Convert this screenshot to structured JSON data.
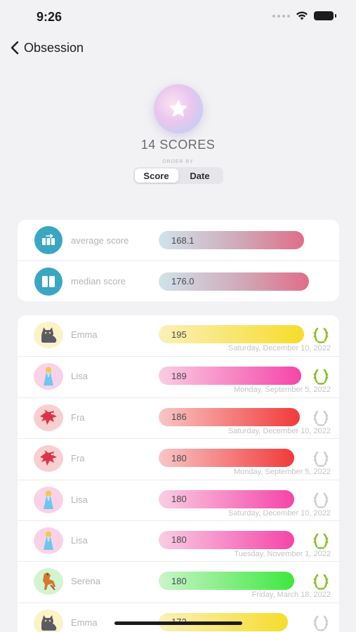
{
  "status_bar": {
    "time": "9:26"
  },
  "nav": {
    "back_title": "Obsession"
  },
  "header": {
    "scores_count": "14 SCORES",
    "order_by_label": "ORDER BY",
    "order_options": [
      "Score",
      "Date"
    ],
    "selected_order": "Score"
  },
  "stats": [
    {
      "label": "average score",
      "value": "168.1",
      "icon": "average-icon"
    },
    {
      "label": "median score",
      "value": "176.0",
      "icon": "median-icon"
    }
  ],
  "scores": [
    {
      "name": "Emma",
      "score": "195",
      "date": "Saturday, December 10, 2022",
      "avatar": "cat-icon",
      "avatar_bg": "#fbf3c8",
      "bar_from": "#fbf0b8",
      "bar_to": "#f6dc2c",
      "bar_fraction": 1.0,
      "laurel_color": "#8fbf2a"
    },
    {
      "name": "Lisa",
      "score": "189",
      "date": "Monday, September 5, 2022",
      "avatar": "princess-icon",
      "avatar_bg": "#f9d2e8",
      "bar_from": "#f9cde3",
      "bar_to": "#f545a8",
      "bar_fraction": 0.98,
      "laurel_color": "#8fbf2a"
    },
    {
      "name": "Fra",
      "score": "186",
      "date": "Saturday, December 10, 2022",
      "avatar": "dragon-icon",
      "avatar_bg": "#f8cfcf",
      "bar_from": "#f8c6c6",
      "bar_to": "#f23a3a",
      "bar_fraction": 0.97,
      "laurel_color": "#cfcfd2"
    },
    {
      "name": "Fra",
      "score": "180",
      "date": "Monday, September 5, 2022",
      "avatar": "dragon-icon",
      "avatar_bg": "#f8cfcf",
      "bar_from": "#f8c6c6",
      "bar_to": "#f23a3a",
      "bar_fraction": 0.93,
      "laurel_color": "#cfcfd2"
    },
    {
      "name": "Lisa",
      "score": "180",
      "date": "Saturday, December 10, 2022",
      "avatar": "princess-icon",
      "avatar_bg": "#f9d2e8",
      "bar_from": "#f9cde3",
      "bar_to": "#f545a8",
      "bar_fraction": 0.93,
      "laurel_color": "#cfcfd2"
    },
    {
      "name": "Lisa",
      "score": "180",
      "date": "Tuesday, November 1, 2022",
      "avatar": "princess-icon",
      "avatar_bg": "#f9d2e8",
      "bar_from": "#f9cde3",
      "bar_to": "#f545a8",
      "bar_fraction": 0.93,
      "laurel_color": "#8fbf2a"
    },
    {
      "name": "Serena",
      "score": "180",
      "date": "Friday, March 18, 2022",
      "avatar": "horse-icon",
      "avatar_bg": "#d2f4d2",
      "bar_from": "#c9f5c9",
      "bar_to": "#3ee83e",
      "bar_fraction": 0.93,
      "laurel_color": "#8fbf2a"
    },
    {
      "name": "Emma",
      "score": "172",
      "date": "",
      "avatar": "cat-icon",
      "avatar_bg": "#fbf3c8",
      "bar_from": "#fbf0b8",
      "bar_to": "#f6dc2c",
      "bar_fraction": 0.89,
      "laurel_color": "#cfcfd2"
    }
  ]
}
